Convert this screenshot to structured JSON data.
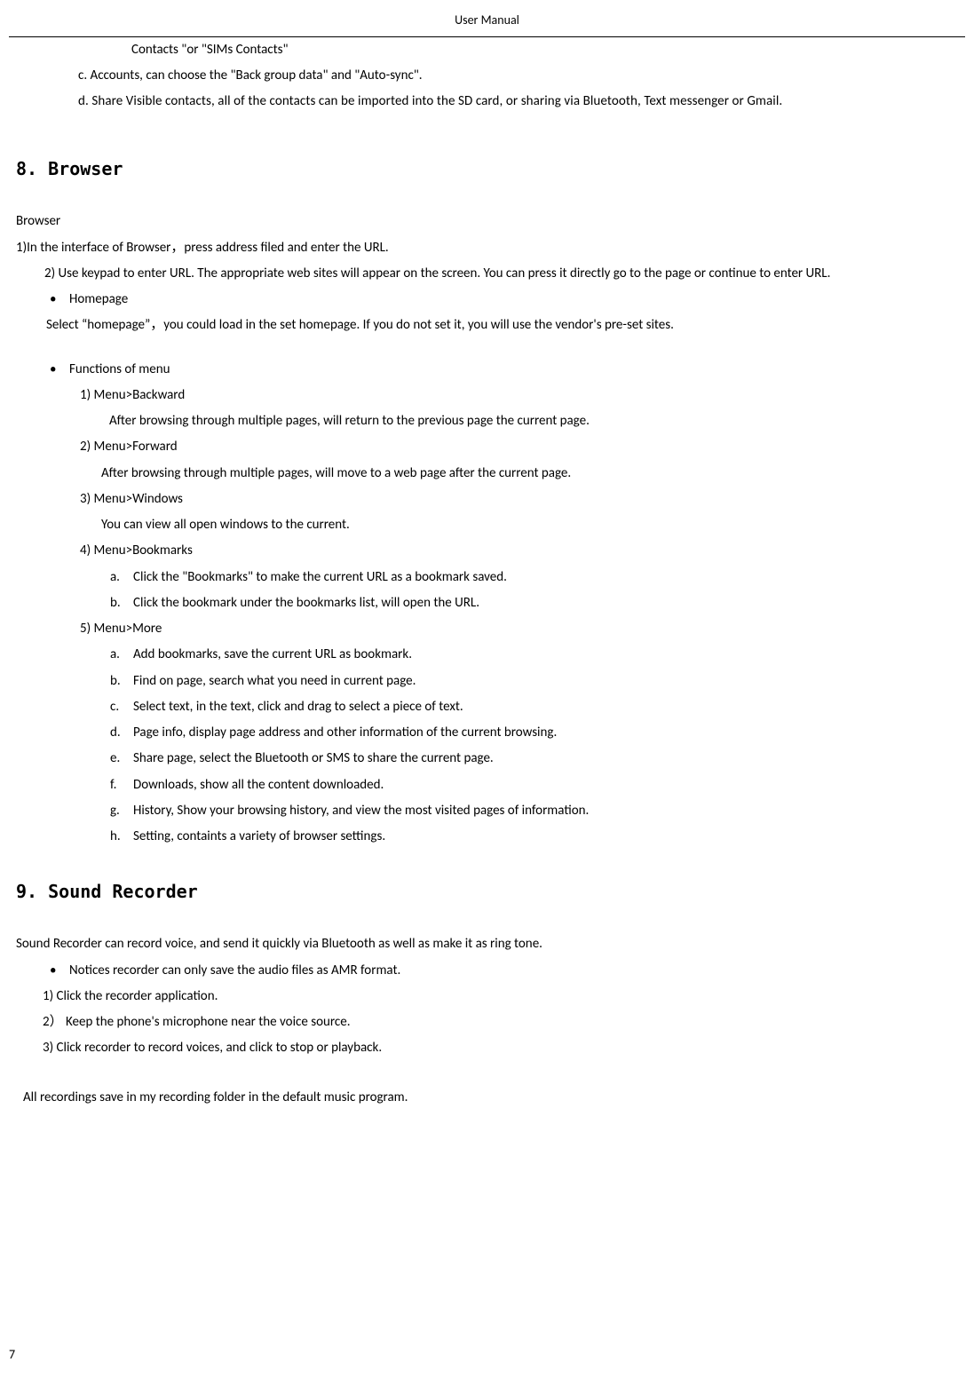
{
  "header": {
    "title": "User Manual"
  },
  "top": {
    "lineA": "Contacts \"or \"SIMs Contacts\"",
    "lineC": "c. Accounts, can choose the \"Back group data\" and \"Auto-sync\".",
    "lineD": "d. Share Visible contacts, all of the contacts can be imported into the SD card, or sharing via Bluetooth, Text messenger or Gmail."
  },
  "sec8": {
    "heading": "8. Browser",
    "sub": "Browser",
    "l1": "1)In the interface of Browser，press address filed and enter the URL.",
    "l2": "2) Use keypad to enter URL. The appropriate web sites will appear on the screen. You can press it directly go to the page or continue to enter URL.",
    "bullet1": "Homepage",
    "sel": "Select   “homepage”，you could load in the set homepage. If you do not set it, you will use the vendor's pre-set sites.",
    "bullet2": "Functions of menu",
    "m1": "1)   Menu>Backward",
    "m1b": "After browsing through multiple pages, will return to the previous page the current page.",
    "m2": "2)   Menu>Forward",
    "m2b": "After browsing through multiple pages, will move to a web page after the current page.",
    "m3": "3)   Menu>Windows",
    "m3b": "You can view all open windows to the current.",
    "m4": "4)   Menu>Bookmarks",
    "m4a": "Click the \"Bookmarks\" to make the current URL as a bookmark saved.",
    "m4b": "Click the bookmark under the bookmarks list, will open the URL.",
    "m5": "5)   Menu>More",
    "m5a": "Add bookmarks, save the current URL as bookmark.",
    "m5b": "Find on page, search what you need in current page.",
    "m5c": "Select text, in the text, click and drag to select a piece of text.",
    "m5d": "Page info, display page address and other information of the current browsing.",
    "m5e": "Share page, select the Bluetooth or SMS to share the current page.",
    "m5f": "Downloads, show all the content downloaded.",
    "m5g": "History, Show your browsing history, and view the most visited pages of information.",
    "m5h": "Setting, containts a variety of browser settings."
  },
  "sec9": {
    "heading": "9. Sound Recorder",
    "intro": "Sound Recorder can record voice, and send it quickly via Bluetooth as well as make it as ring tone.",
    "bullet": "Notices recorder can only save the audio files as AMR format.",
    "s1": "1) Click the recorder application.",
    "s2": "2） Keep the phone's microphone near the voice source.",
    "s3": "3) Click recorder to record voices, and click to stop or playback.",
    "end": "All recordings save in my recording folder in the default music program."
  },
  "pageNumber": "7"
}
